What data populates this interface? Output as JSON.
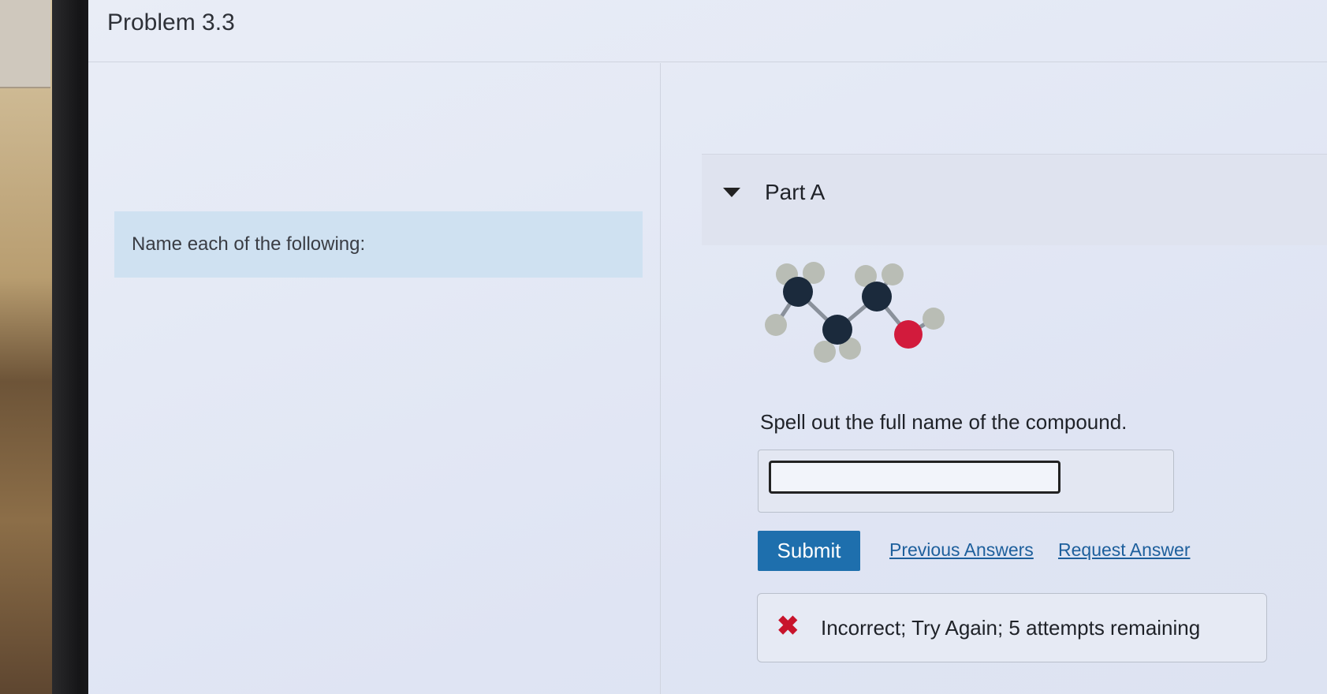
{
  "page": {
    "title": "Problem 3.3"
  },
  "prompt": {
    "text": "Name each of the following:"
  },
  "part": {
    "label": "Part A",
    "instruction": "Spell out the full name of the compound."
  },
  "answer": {
    "value": "",
    "placeholder": ""
  },
  "actions": {
    "submit_label": "Submit",
    "previous_answers_label": "Previous Answers",
    "request_answer_label": "Request Answer"
  },
  "feedback": {
    "icon": "x-mark-icon",
    "text": "Incorrect; Try Again; 5 attempts remaining",
    "color": "#c8142c"
  },
  "colors": {
    "accent": "#1e6fad",
    "link": "#1d5f9c",
    "prompt_bg": "#cfe1f1",
    "carbon": "#1b2a3c",
    "hydrogen": "#b9bdb5",
    "oxygen": "#d21b3c"
  }
}
